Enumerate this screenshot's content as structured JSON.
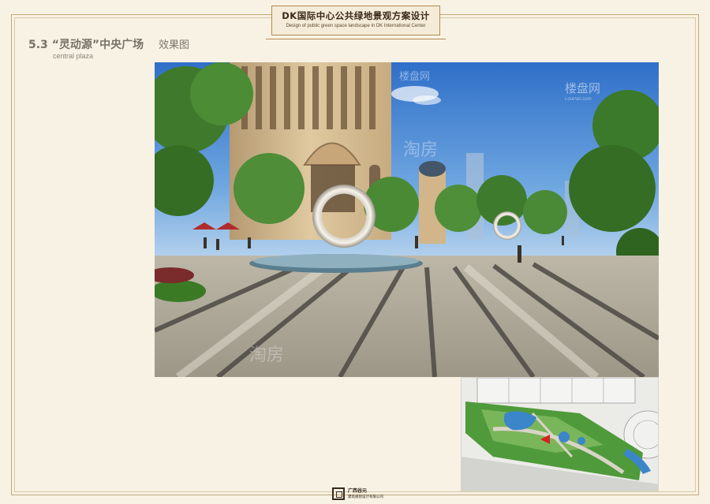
{
  "header": {
    "title": "DK国际中心公共绿地景观方案设计",
    "subtitle": "Design of public green space landscape in DK International Center"
  },
  "section": {
    "number": "5.3",
    "name": "“灵动源”中央广场",
    "effect_label": "效果图",
    "english": "central plaza"
  },
  "watermarks": {
    "top_right": "楼盘网",
    "top_right_small": "LouPan.com",
    "top_mid": "楼盘网",
    "center": "淘房",
    "bottom_left": "淘房"
  },
  "footer": {
    "company_line1": "广西谷元",
    "company_line2": "建筑规划设计有限公司"
  },
  "colors": {
    "border": "#c2a97a",
    "header_border": "#b48a4e",
    "background": "#f7f2e4",
    "title_text": "#777266"
  }
}
